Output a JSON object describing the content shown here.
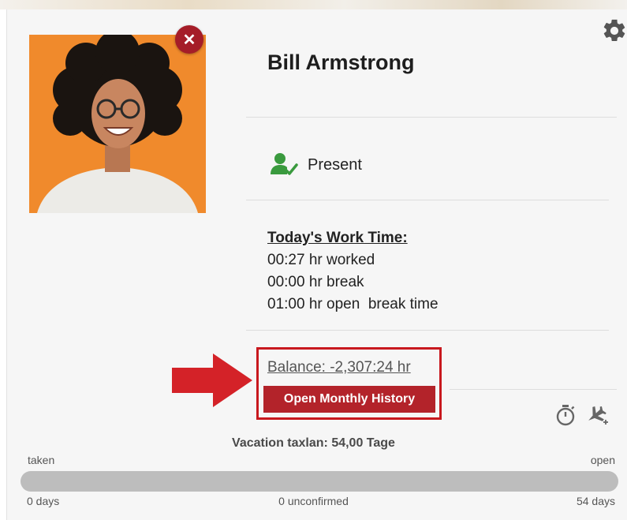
{
  "profile": {
    "name": "Bill Armstrong",
    "status": "Present"
  },
  "worktime": {
    "heading": "Today's Work Time:",
    "worked": "00:27 hr worked",
    "break": "00:00 hr break",
    "open_break": "01:00 hr open  break time"
  },
  "balance": {
    "label": "Balance: -2,307:24 hr",
    "button": "Open Monthly History"
  },
  "vacation": {
    "title": "Vacation taxlan: 54,00 Tage",
    "taken_label": "taken",
    "open_label": "open",
    "taken_days": "0 days",
    "unconfirmed": "0 unconfirmed",
    "open_days": "54 days"
  },
  "icons": {
    "close": "close-icon",
    "settings": "gear-icon",
    "status": "user-check-icon",
    "timer": "stopwatch-icon",
    "vacation": "airplane-plus-icon",
    "annotation": "red-arrow"
  },
  "colors": {
    "accent": "#b3232a",
    "status_green": "#3a9a3e",
    "photo_bg": "#f08a2c",
    "highlight": "#c8181e"
  }
}
